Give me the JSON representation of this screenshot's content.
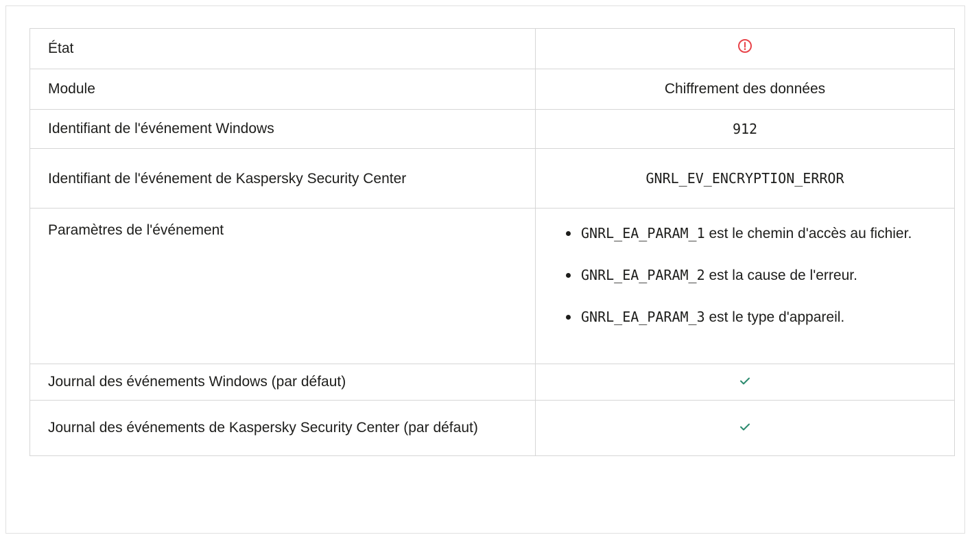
{
  "table": {
    "rows": [
      {
        "label": "État",
        "value_icon": "error-circle-icon"
      },
      {
        "label": "Module",
        "value": "Chiffrement des données"
      },
      {
        "label": "Identifiant de l'événement Windows",
        "value": "912"
      },
      {
        "label": "Identifiant de l'événement de Kaspersky Security Center",
        "value": "GNRL_EV_ENCRYPTION_ERROR"
      },
      {
        "label": "Paramètres de l'événement",
        "params": [
          {
            "code": "GNRL_EA_PARAM_1",
            "text": " est le chemin d'accès au fichier."
          },
          {
            "code": "GNRL_EA_PARAM_2",
            "text": " est la cause de l'erreur."
          },
          {
            "code": "GNRL_EA_PARAM_3",
            "text": " est le type d'appareil."
          }
        ]
      },
      {
        "label": "Journal des événements Windows (par défaut)",
        "value_icon": "check-icon"
      },
      {
        "label": "Journal des événements de Kaspersky Security Center (par défaut)",
        "value_icon": "check-icon"
      }
    ]
  },
  "colors": {
    "error": "#e8444a",
    "check": "#2b8a6e",
    "border": "#d6d6d6"
  }
}
